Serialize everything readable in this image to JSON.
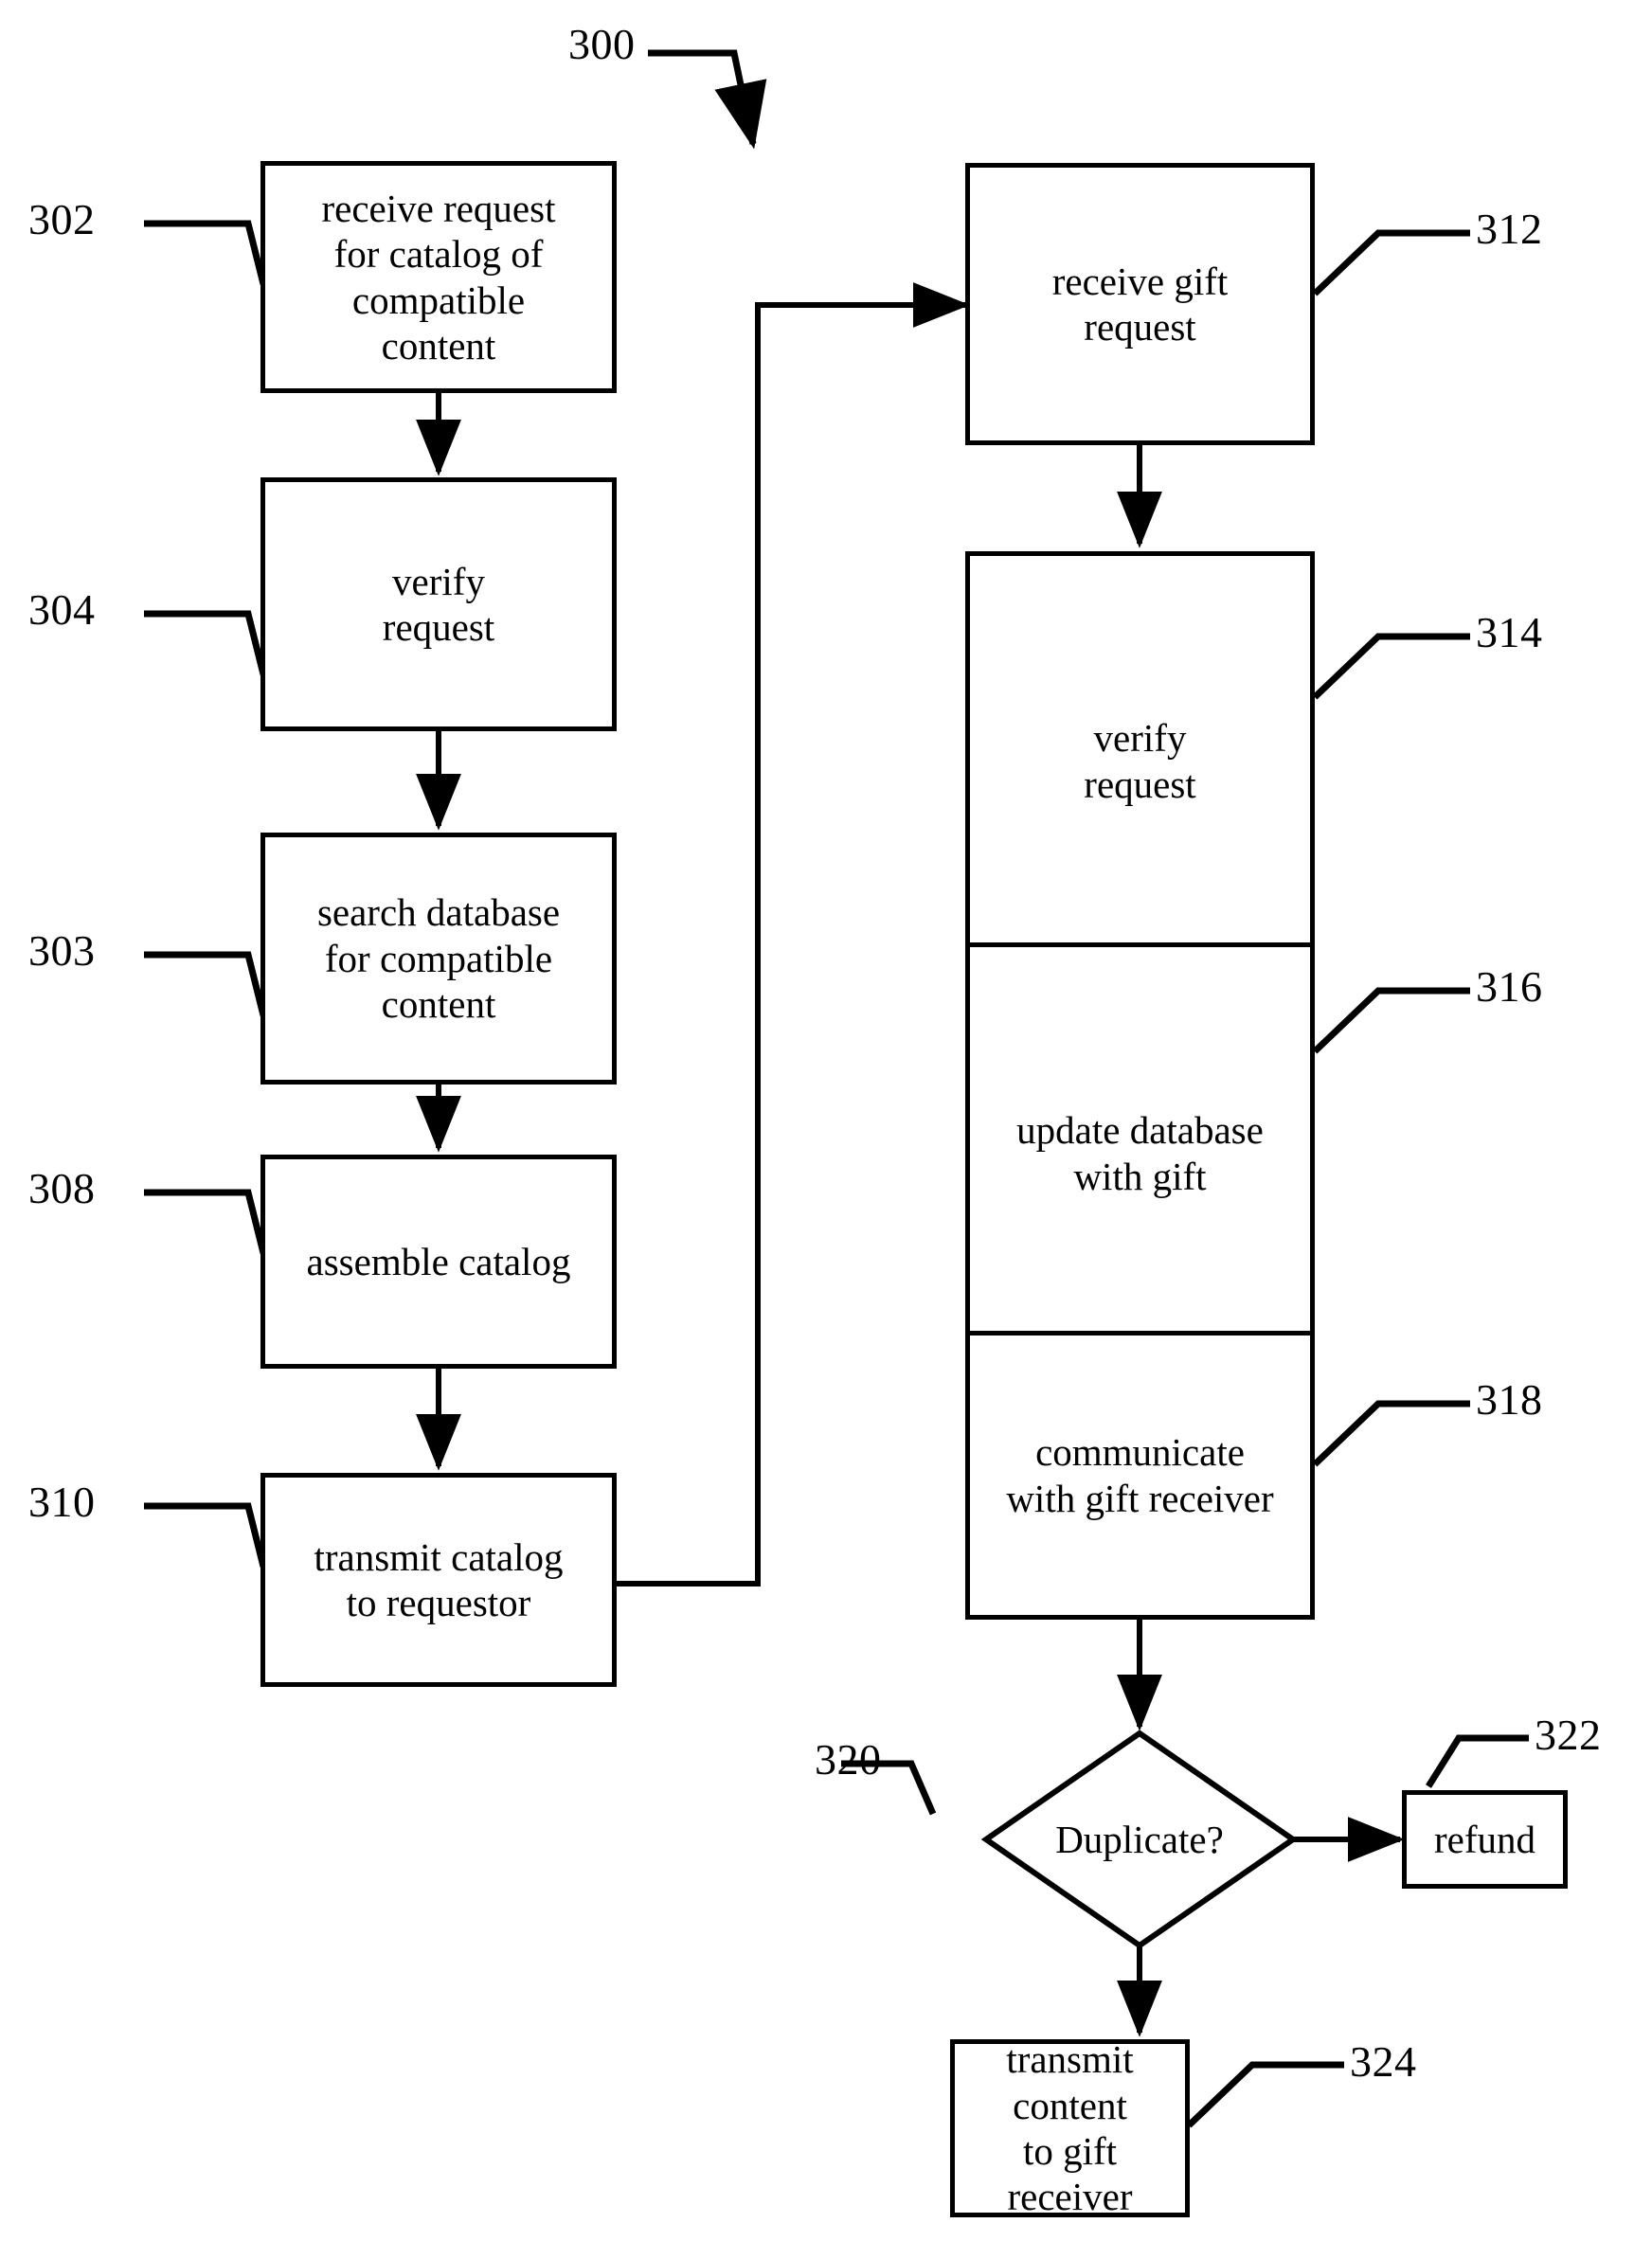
{
  "figure": {
    "figure_number": "300"
  },
  "nodes": {
    "n302": {
      "ref": "302",
      "text": "receive request\nfor catalog of\ncompatible\ncontent"
    },
    "n304": {
      "ref": "304",
      "text": "verify\nrequest"
    },
    "n303": {
      "ref": "303",
      "text": "search database\nfor compatible\ncontent"
    },
    "n308": {
      "ref": "308",
      "text": "assemble catalog"
    },
    "n310": {
      "ref": "310",
      "text": "transmit catalog\nto requestor"
    },
    "n312": {
      "ref": "312",
      "text": "receive gift\nrequest"
    },
    "n314": {
      "ref": "314",
      "text": "verify\nrequest"
    },
    "n316": {
      "ref": "316",
      "text": "update database\nwith gift"
    },
    "n318": {
      "ref": "318",
      "text": "communicate\nwith gift receiver"
    },
    "n320": {
      "ref": "320",
      "text": "Duplicate?"
    },
    "n322": {
      "ref": "322",
      "text": "refund"
    },
    "n324": {
      "ref": "324",
      "text": "transmit content\nto gift receiver"
    }
  },
  "style": {
    "stroke": "#000000",
    "fill": "#ffffff"
  }
}
